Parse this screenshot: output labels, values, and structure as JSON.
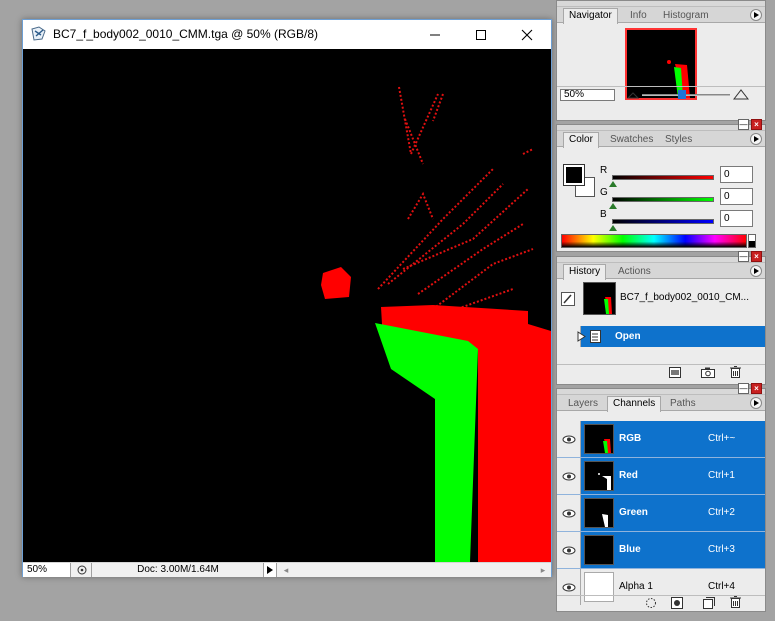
{
  "document": {
    "title": "BC7_f_body002_0010_CMM.tga @ 50% (RGB/8)",
    "zoom": "50%",
    "doc_info": "Doc: 3.00M/1.64M"
  },
  "navigator": {
    "tabs": [
      "Navigator",
      "Info",
      "Histogram"
    ],
    "zoom": "50%",
    "zoom_level": 0.45
  },
  "color": {
    "tabs": [
      "Color",
      "Swatches",
      "Styles"
    ],
    "channels": [
      {
        "label": "R",
        "value": "0",
        "color": "#ff0000"
      },
      {
        "label": "G",
        "value": "0",
        "color": "#00ff00"
      },
      {
        "label": "B",
        "value": "0",
        "color": "#0000ff"
      }
    ],
    "foreground": "#000000",
    "background": "#ffffff"
  },
  "history": {
    "tabs": [
      "History",
      "Actions"
    ],
    "snapshot_label": "BC7_f_body002_0010_CM...",
    "step_label": "Open"
  },
  "channels": {
    "tabs": [
      "Layers",
      "Channels",
      "Paths"
    ],
    "rows": [
      {
        "name": "RGB",
        "shortcut": "Ctrl+~"
      },
      {
        "name": "Red",
        "shortcut": "Ctrl+1"
      },
      {
        "name": "Green",
        "shortcut": "Ctrl+2"
      },
      {
        "name": "Blue",
        "shortcut": "Ctrl+3"
      },
      {
        "name": "Alpha 1",
        "shortcut": "Ctrl+4"
      }
    ]
  },
  "colors": {
    "selection": "#0e72cc",
    "image_red": "#ff0000",
    "image_green": "#00ff00"
  }
}
